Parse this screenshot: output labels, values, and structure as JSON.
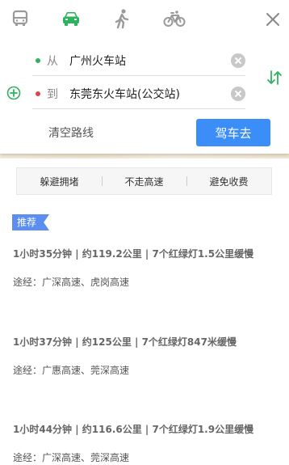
{
  "modes": [
    "bus",
    "car",
    "walk",
    "bike"
  ],
  "colors": {
    "accent": "#3b8ef7",
    "active_mode": "#2db35e",
    "start_dot": "#2db35e",
    "end_dot": "#e04545",
    "tag": "#5b8ef0"
  },
  "route_input": {
    "start_prefix": "从",
    "start_value": "广州火车站",
    "end_prefix": "到",
    "end_value": "东莞东火车站(公交站)"
  },
  "actions": {
    "clear_route": "清空路线",
    "drive": "驾车去"
  },
  "preferences": [
    "躲避拥堵",
    "不走高速",
    "避免收费"
  ],
  "recommend_tag": "推荐",
  "routes": [
    {
      "summary": "1小时35分钟 | 约119.2公里 | 7个红绿灯1.5公里缓慢",
      "via": "途经：广深高速、虎岗高速"
    },
    {
      "summary": "1小时37分钟 | 约125公里 | 7个红绿灯847米缓慢",
      "via": "途经：广惠高速、莞深高速"
    },
    {
      "summary": "1小时44分钟 | 约116.6公里 | 7个红绿灯1.9公里缓慢",
      "via": "途经：广深高速、莞深高速"
    }
  ]
}
